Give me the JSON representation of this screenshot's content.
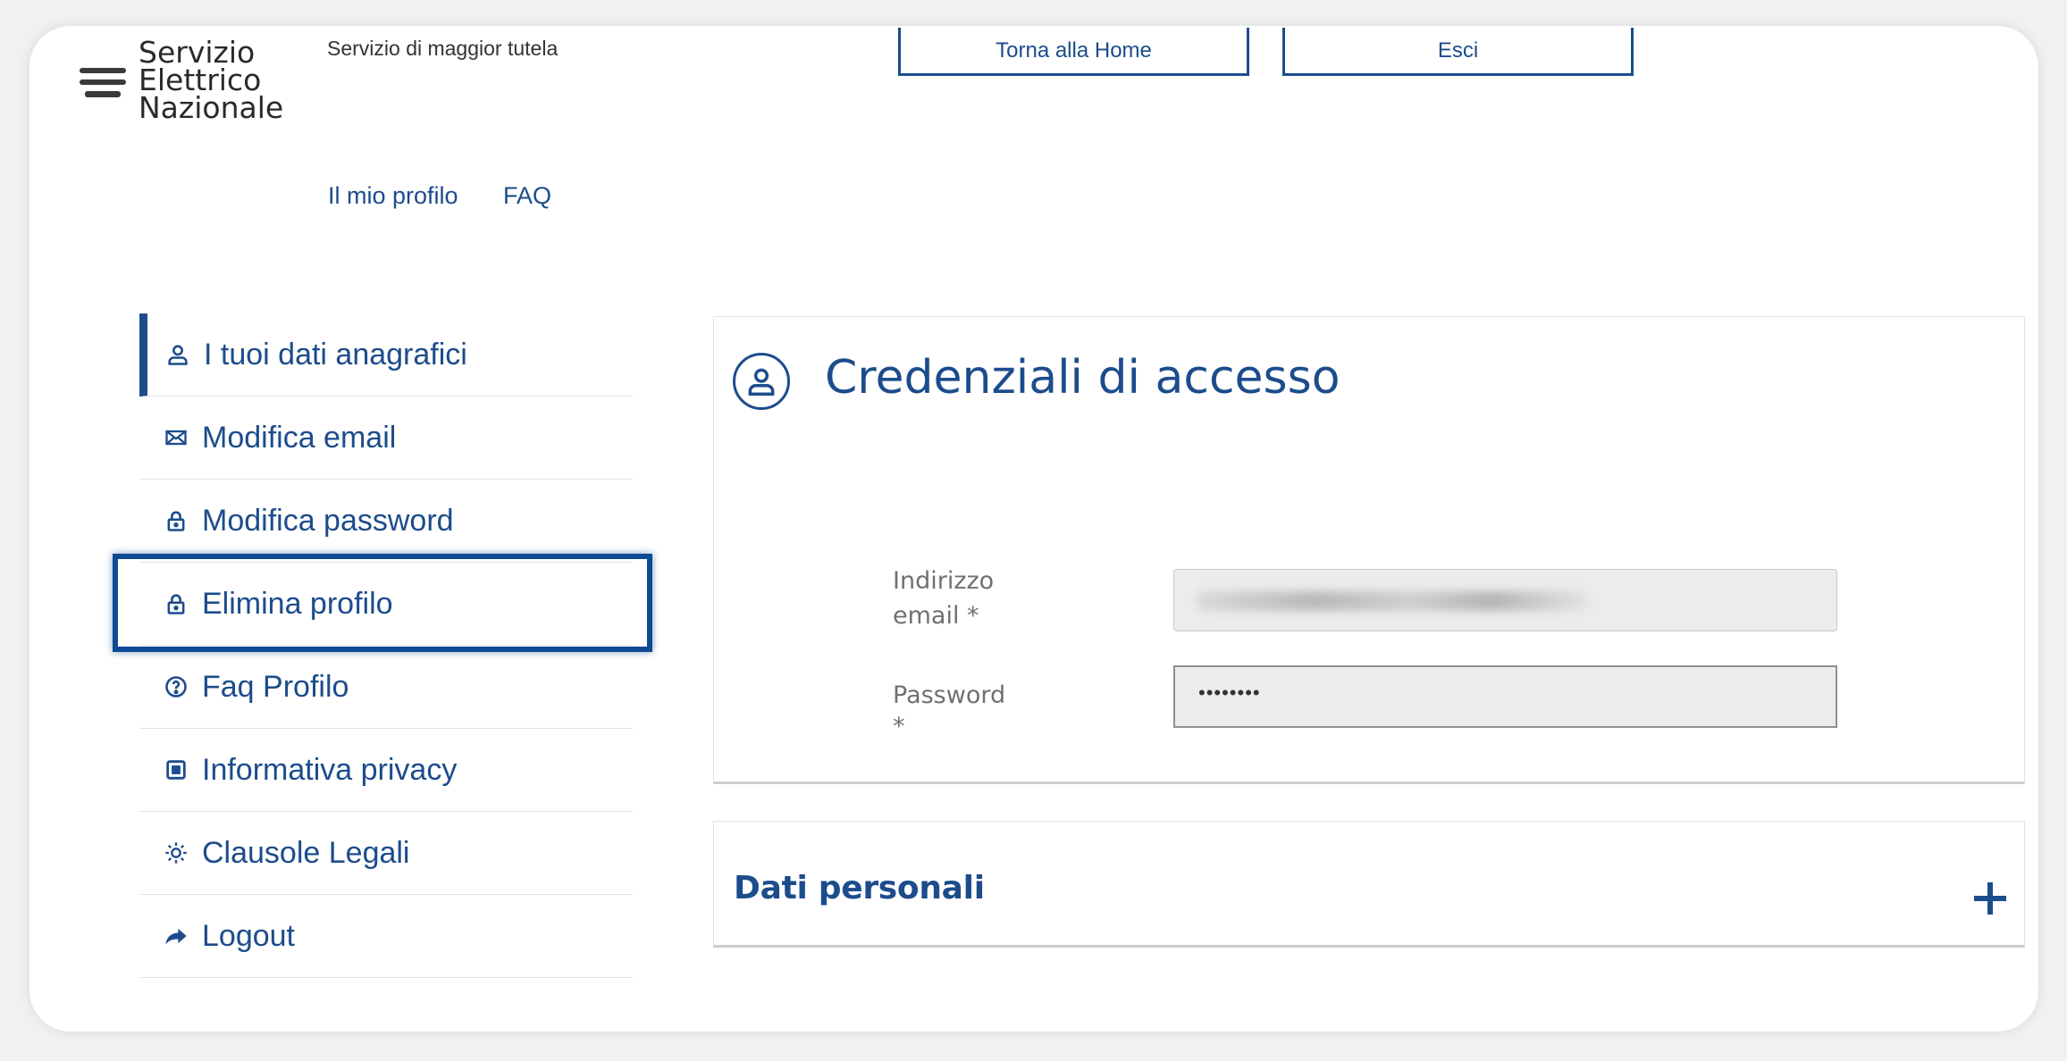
{
  "brand": {
    "lines": [
      "Servizio",
      "Elettrico",
      "Nazionale"
    ],
    "tagline": "Servizio di maggior tutela"
  },
  "header": {
    "home_button": "Torna alla Home",
    "exit_button": "Esci",
    "nav": [
      "Il mio profilo",
      "FAQ"
    ]
  },
  "sidebar": {
    "items": [
      {
        "label": "I tuoi dati anagrafici",
        "icon": "user-icon",
        "active": true
      },
      {
        "label": "Modifica email",
        "icon": "envelope-icon"
      },
      {
        "label": "Modifica password",
        "icon": "lock-icon"
      },
      {
        "label": "Elimina profilo",
        "icon": "lock-icon",
        "highlighted": true
      },
      {
        "label": "Faq Profilo",
        "icon": "question-circle-icon"
      },
      {
        "label": "Informativa privacy",
        "icon": "privacy-icon"
      },
      {
        "label": "Clausole Legali",
        "icon": "sun-icon"
      },
      {
        "label": "Logout",
        "icon": "share-arrow-icon"
      }
    ]
  },
  "credentials": {
    "title": "Credenziali di accesso",
    "email_label_1": "Indirizzo",
    "email_label_2": "email *",
    "password_label_1": "Password",
    "password_label_2": "*",
    "password_value": "••••••••"
  },
  "personal": {
    "title": "Dati personali"
  },
  "colors": {
    "accent": "#1c4c8c",
    "highlight": "#0c4a94"
  }
}
